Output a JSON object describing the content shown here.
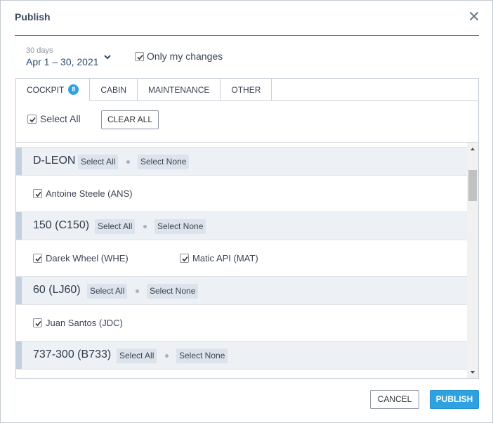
{
  "dialog": {
    "title": "Publish",
    "close_icon": "close-icon"
  },
  "period": {
    "label": "30 days",
    "range": "Apr 1 – 30, 2021",
    "chevron_icon": "chevron-down-icon"
  },
  "only_my_changes": {
    "label": "Only my changes",
    "checked": true
  },
  "tabs": [
    {
      "label": "COCKPIT",
      "badge": "8",
      "active": true
    },
    {
      "label": "CABIN"
    },
    {
      "label": "MAINTENANCE"
    },
    {
      "label": "OTHER"
    }
  ],
  "toolbar": {
    "select_all_label": "Select All",
    "select_all_checked": true,
    "clear_all_label": "CLEAR ALL"
  },
  "groups": [
    {
      "name": "D-LEON",
      "select_all": "Select All",
      "select_none": "Select None",
      "members": [
        {
          "name": "Antoine Steele (ANS)",
          "checked": true
        }
      ]
    },
    {
      "name": "150 (C150)",
      "select_all": "Select All",
      "select_none": "Select None",
      "members": [
        {
          "name": "Darek Wheel (WHE)",
          "checked": true
        },
        {
          "name": "Matic API (MAT)",
          "checked": true
        }
      ]
    },
    {
      "name": "60 (LJ60)",
      "select_all": "Select All",
      "select_none": "Select None",
      "members": [
        {
          "name": "Juan Santos (JDC)",
          "checked": true
        }
      ]
    },
    {
      "name": "737-300 (B733)",
      "select_all": "Select All",
      "select_none": "Select None",
      "members": []
    }
  ],
  "footer": {
    "cancel_label": "CANCEL",
    "publish_label": "PUBLISH"
  },
  "colors": {
    "accent": "#2ea2e0",
    "group_bg": "#edf0f4",
    "chip_bg": "#dde3ea"
  }
}
